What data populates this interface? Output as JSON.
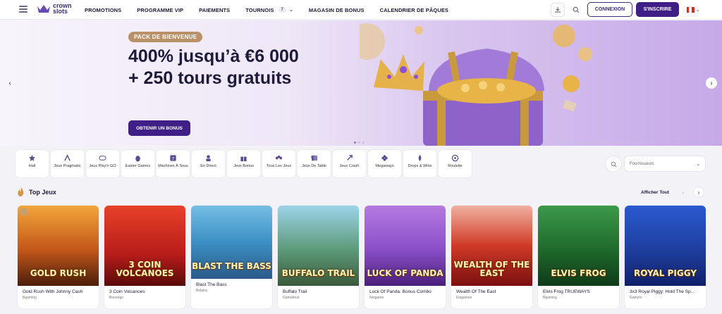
{
  "header": {
    "logo_line1": "crown",
    "logo_line2": "slots",
    "nav": [
      "PROMOTIONS",
      "PROGRAMME VIP",
      "PAIEMENTS",
      "TOURNOIS",
      "MAGASIN DE BONUS",
      "CALENDRIER DE PÂQUES"
    ],
    "tournois_count": "7",
    "login_label": "CONNEXION",
    "signup_label": "S'INSCRIRE"
  },
  "hero": {
    "pill": "PACK DE BIENVENUE",
    "title": "400% jusqu’à €6 000 + 250 tours gratuits",
    "cta": "OBTENIR UN BONUS"
  },
  "categories": [
    {
      "label": "Hall",
      "icon": "star-icon"
    },
    {
      "label": "Jeux Pragmatic",
      "icon": "pragmatic-icon"
    },
    {
      "label": "Jeux Play'n GO",
      "icon": "playngo-icon"
    },
    {
      "label": "Easter Games",
      "icon": "easter-icon"
    },
    {
      "label": "Machines À Sous",
      "icon": "slot-icon"
    },
    {
      "label": "En Direct",
      "icon": "live-icon"
    },
    {
      "label": "Jeux Bonus",
      "icon": "gift-icon"
    },
    {
      "label": "Tous Les Jeux",
      "icon": "all-games-icon"
    },
    {
      "label": "Jeux De Table",
      "icon": "cards-icon"
    },
    {
      "label": "Jeux Crash",
      "icon": "rocket-icon"
    },
    {
      "label": "Megaways",
      "icon": "clover-icon"
    },
    {
      "label": "Drops & Wins",
      "icon": "drops-icon"
    },
    {
      "label": "Roulette",
      "icon": "roulette-icon"
    }
  ],
  "providers_placeholder": "Fournisseurs",
  "top_games": {
    "title": "Top Jeux",
    "see_all": "Afficher Tout",
    "items": [
      {
        "name": "Gold Rush With Johnny Cash",
        "provider": "Bgaming",
        "art": "GOLD RUSH",
        "bg": "#5a2a10"
      },
      {
        "name": "3 Coin Volcanoes",
        "provider": "Booongo",
        "art": "3 COIN VOLCANOES",
        "bg": "#c0261a"
      },
      {
        "name": "Blast The Bass",
        "provider": "Belatra",
        "art": "BLAST THE BASS",
        "bg": "#3aa0d6"
      },
      {
        "name": "Buffalo Trail",
        "provider": "Gamebeat",
        "art": "BUFFALO TRAIL",
        "bg": "#4a7a8a"
      },
      {
        "name": "Luck Of Panda: Bonus Combo",
        "provider": "Netgame",
        "art": "LUCK OF PANDA",
        "bg": "#7a3fb0"
      },
      {
        "name": "Wealth Of The East",
        "provider": "Elagames",
        "art": "WEALTH OF THE EAST",
        "bg": "#b0201c"
      },
      {
        "name": "Elvis Frog TRUEWAYS",
        "provider": "Bgaming",
        "art": "ELVIS FROG",
        "bg": "#1a5a2a"
      },
      {
        "name": "3x3 Royal Piggy: Hold The Sp...",
        "provider": "Gamzix",
        "art": "ROYAL PIGGY",
        "bg": "#1f3fa0"
      }
    ]
  },
  "colors": {
    "primary": "#3f1f86",
    "gold": "#b99169"
  }
}
